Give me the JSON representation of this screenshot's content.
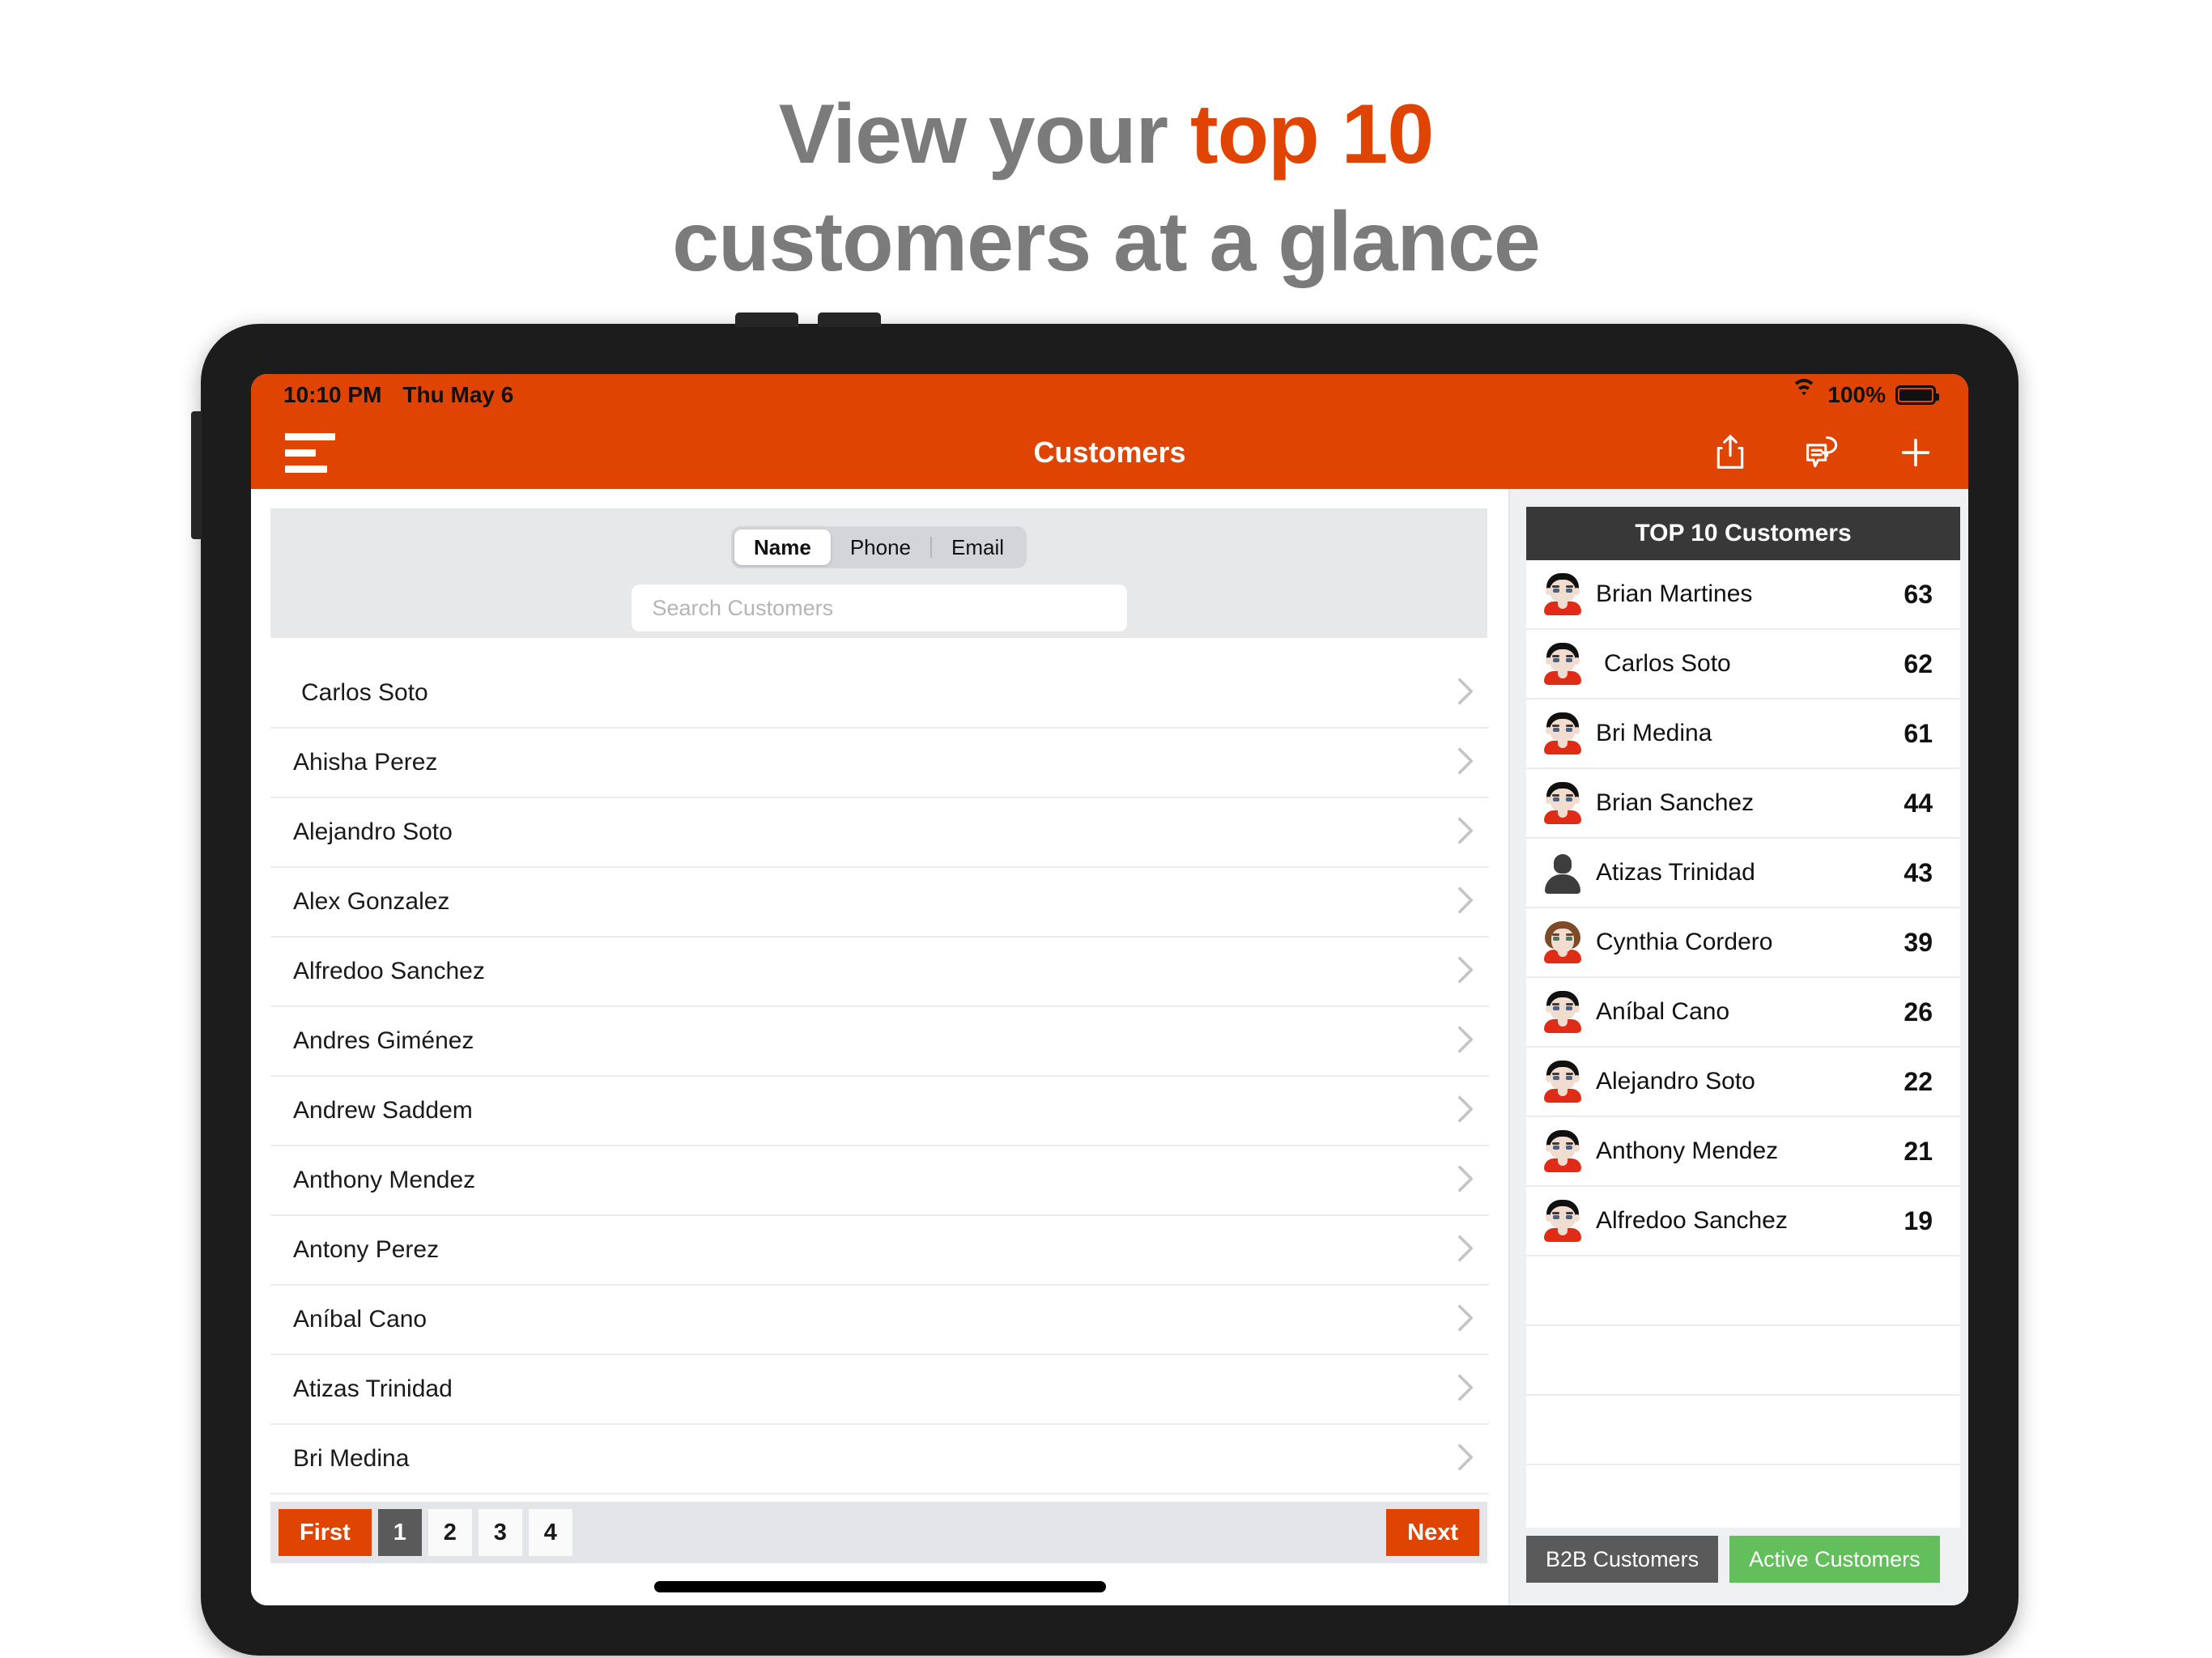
{
  "headline": {
    "line1_pre": "View your ",
    "line1_accent": "top 10",
    "line2": "customers at a glance"
  },
  "colors": {
    "brand_orange": "#e04403",
    "dark_gray": "#383838",
    "green": "#63bf5c",
    "headline_gray": "#7b7b7b"
  },
  "status_bar": {
    "time": "10:10 PM",
    "date": "Thu May 6",
    "battery_percent": "100%",
    "wifi_icon": "wifi-icon",
    "battery_icon": "battery-icon"
  },
  "nav_bar": {
    "title": "Customers",
    "menu_icon": "hamburger-menu-icon",
    "share_icon": "share-icon",
    "chat_icon": "chat-bubble-icon",
    "add_icon": "plus-icon"
  },
  "search": {
    "segments": [
      {
        "label": "Name",
        "active": true
      },
      {
        "label": "Phone",
        "active": false
      },
      {
        "label": "Email",
        "active": false
      }
    ],
    "placeholder": "Search Customers",
    "value": ""
  },
  "customer_list": {
    "chevron_icon": "chevron-right-icon",
    "rows": [
      {
        "name": "Carlos Soto",
        "indent": true
      },
      {
        "name": "Ahisha Perez",
        "indent": false
      },
      {
        "name": "Alejandro Soto",
        "indent": false
      },
      {
        "name": "Alex Gonzalez",
        "indent": false
      },
      {
        "name": "Alfredoo  Sanchez",
        "indent": false
      },
      {
        "name": "Andres  Giménez",
        "indent": false
      },
      {
        "name": "Andrew Saddem",
        "indent": false
      },
      {
        "name": "Anthony  Mendez",
        "indent": false
      },
      {
        "name": "Antony  Perez",
        "indent": false
      },
      {
        "name": "Aníbal Cano",
        "indent": false
      },
      {
        "name": "Atizas Trinidad",
        "indent": false
      },
      {
        "name": "Bri Medina",
        "indent": false
      }
    ]
  },
  "pagination": {
    "first_label": "First",
    "pages": [
      "1",
      "2",
      "3",
      "4"
    ],
    "current_page": "1",
    "next_label": "Next"
  },
  "top10": {
    "header": "TOP 10 Customers",
    "rows": [
      {
        "name": "Brian Martines",
        "value": "63",
        "avatar": "male-avatar",
        "indent": false
      },
      {
        "name": "Carlos Soto",
        "value": "62",
        "avatar": "male-avatar",
        "indent": true
      },
      {
        "name": "Bri Medina",
        "value": "61",
        "avatar": "male-avatar",
        "indent": false
      },
      {
        "name": "Brian  Sanchez",
        "value": "44",
        "avatar": "male-avatar",
        "indent": false
      },
      {
        "name": "Atizas Trinidad",
        "value": "43",
        "avatar": "generic-avatar",
        "indent": false
      },
      {
        "name": "Cynthia  Cordero",
        "value": "39",
        "avatar": "female-avatar",
        "indent": false
      },
      {
        "name": "Aníbal Cano",
        "value": "26",
        "avatar": "male-avatar",
        "indent": false
      },
      {
        "name": "Alejandro Soto",
        "value": "22",
        "avatar": "male-avatar",
        "indent": false
      },
      {
        "name": "Anthony  Mendez",
        "value": "21",
        "avatar": "male-avatar",
        "indent": false
      },
      {
        "name": "Alfredoo  Sanchez",
        "value": "19",
        "avatar": "male-avatar",
        "indent": false
      }
    ],
    "empty_rows": 3
  },
  "right_footer": {
    "b2b_label": "B2B Customers",
    "active_label": "Active Customers"
  }
}
